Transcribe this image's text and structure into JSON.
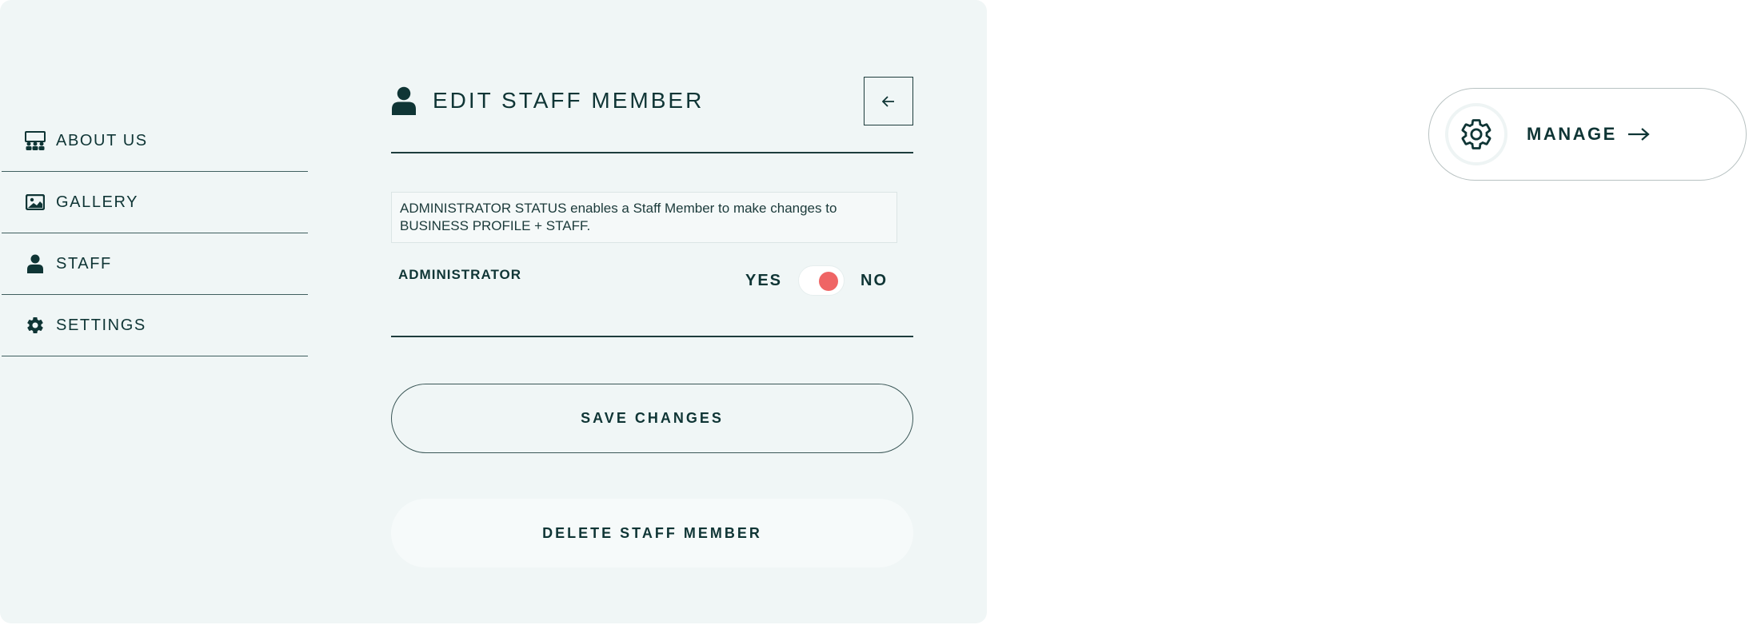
{
  "sidebar": {
    "items": [
      {
        "label": "ABOUT US",
        "icon": "team-board-icon"
      },
      {
        "label": "GALLERY",
        "icon": "image-icon"
      },
      {
        "label": "STAFF",
        "icon": "person-icon"
      },
      {
        "label": "SETTINGS",
        "icon": "gear-icon"
      }
    ]
  },
  "header": {
    "title": "EDIT STAFF MEMBER",
    "title_icon": "person-icon",
    "back_icon": "arrow-left-icon"
  },
  "info": {
    "text": "ADMINISTRATOR STATUS enables a Staff Member to make changes to BUSINESS PROFILE + STAFF."
  },
  "administrator": {
    "label": "ADMINISTRATOR",
    "yes_label": "YES",
    "no_label": "NO",
    "toggle_state": "NO"
  },
  "actions": {
    "save_label": "SAVE CHANGES",
    "delete_label": "DELETE STAFF MEMBER"
  },
  "manage": {
    "label": "MANAGE",
    "icon": "gear-icon",
    "arrow_icon": "arrow-right-icon"
  },
  "colors": {
    "panel_bg": "#f0f6f6",
    "text_dark": "#0f3535",
    "toggle_knob": "#ef6565"
  }
}
